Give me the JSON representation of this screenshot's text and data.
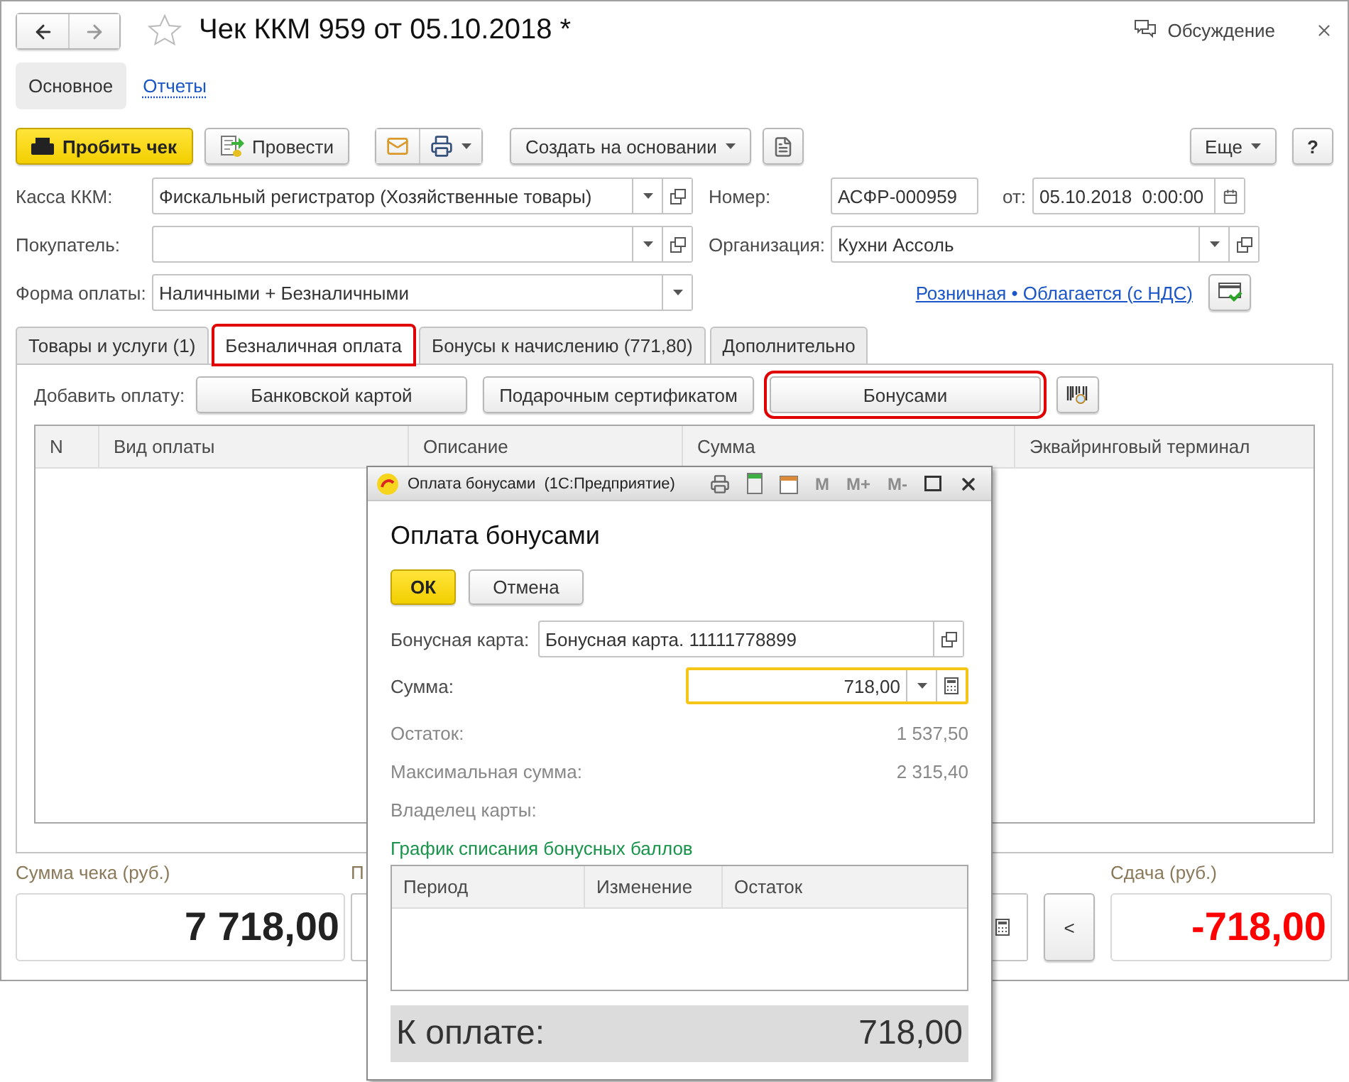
{
  "window": {
    "title": "Чек ККМ 959 от 05.10.2018 *",
    "favorite": false,
    "discussion": "Обсуждение"
  },
  "sections": [
    {
      "label": "Основное",
      "selected": true
    },
    {
      "label": "Отчеты",
      "selected": false
    }
  ],
  "toolbar": {
    "primary": "Пробить чек",
    "post": "Провести",
    "create": "Создать на основании",
    "more": "Еще",
    "help": "?"
  },
  "fields": {
    "cash_register": {
      "label": "Касса ККМ:",
      "value": "Фискальный регистратор (Хозяйственные товары)"
    },
    "number": {
      "label": "Номер:",
      "value": "АСФР-000959"
    },
    "date": {
      "label": "от:",
      "value": "05.10.2018  0:00:00"
    },
    "buyer": {
      "label": "Покупатель:"
    },
    "organization": {
      "label": "Организация:",
      "value": "Кухни Ассоль"
    },
    "payment_form": {
      "label": "Форма оплаты:",
      "value": "Наличными + Безналичными"
    },
    "tax_link": "Розничная • Облагается (с НДС)"
  },
  "tabs": [
    {
      "label": "Товары и услуги (1)",
      "selected": false,
      "highlighted": false
    },
    {
      "label": "Безналичная оплата",
      "selected": true,
      "highlighted": true
    },
    {
      "label": "Бонусы к начислению (771,80)",
      "selected": false,
      "highlighted": false
    },
    {
      "label": "Дополнительно",
      "selected": false,
      "highlighted": false
    }
  ],
  "payment_panel": {
    "label": "Добавить оплату:",
    "buttons": [
      {
        "label": "Банковской картой",
        "highlighted": false
      },
      {
        "label": "Подарочным сертификатом",
        "highlighted": false
      },
      {
        "label": "Бонусами",
        "highlighted": true
      }
    ],
    "columns": [
      "N",
      "Вид оплаты",
      "Описание",
      "Сумма",
      "Эквайринговый терминал"
    ]
  },
  "footer": {
    "check_sum": {
      "label": "Сумма чека (руб.)",
      "value": "7 718,00"
    },
    "partial_label": "П",
    "back": "<",
    "change": {
      "label": "Сдача (руб.)",
      "value": "-718,00",
      "negative": true
    }
  },
  "dialog": {
    "title": "Оплата бонусами  (1С:Предприятие)",
    "memory": [
      {
        "label": "M",
        "disabled": true
      },
      {
        "label": "M+",
        "disabled": true
      },
      {
        "label": "M-",
        "disabled": true
      }
    ],
    "heading": "Оплата бонусами",
    "ok": "ОК",
    "cancel": "Отмена",
    "card": {
      "label": "Бонусная карта:",
      "value": "Бонусная карта. 11111778899"
    },
    "amount": {
      "label": "Сумма:",
      "value": "718,00",
      "focused": true
    },
    "info": [
      {
        "label": "Остаток:",
        "value": "1 537,50"
      },
      {
        "label": "Максимальная сумма:",
        "value": "2 315,40"
      },
      {
        "label": "Владелец карты:"
      }
    ],
    "schedule_link": "График списания бонусных баллов",
    "schedule_columns": [
      "Период",
      "Изменение",
      "Остаток"
    ],
    "to_pay": {
      "label": "К оплате:",
      "value": "718,00"
    }
  }
}
